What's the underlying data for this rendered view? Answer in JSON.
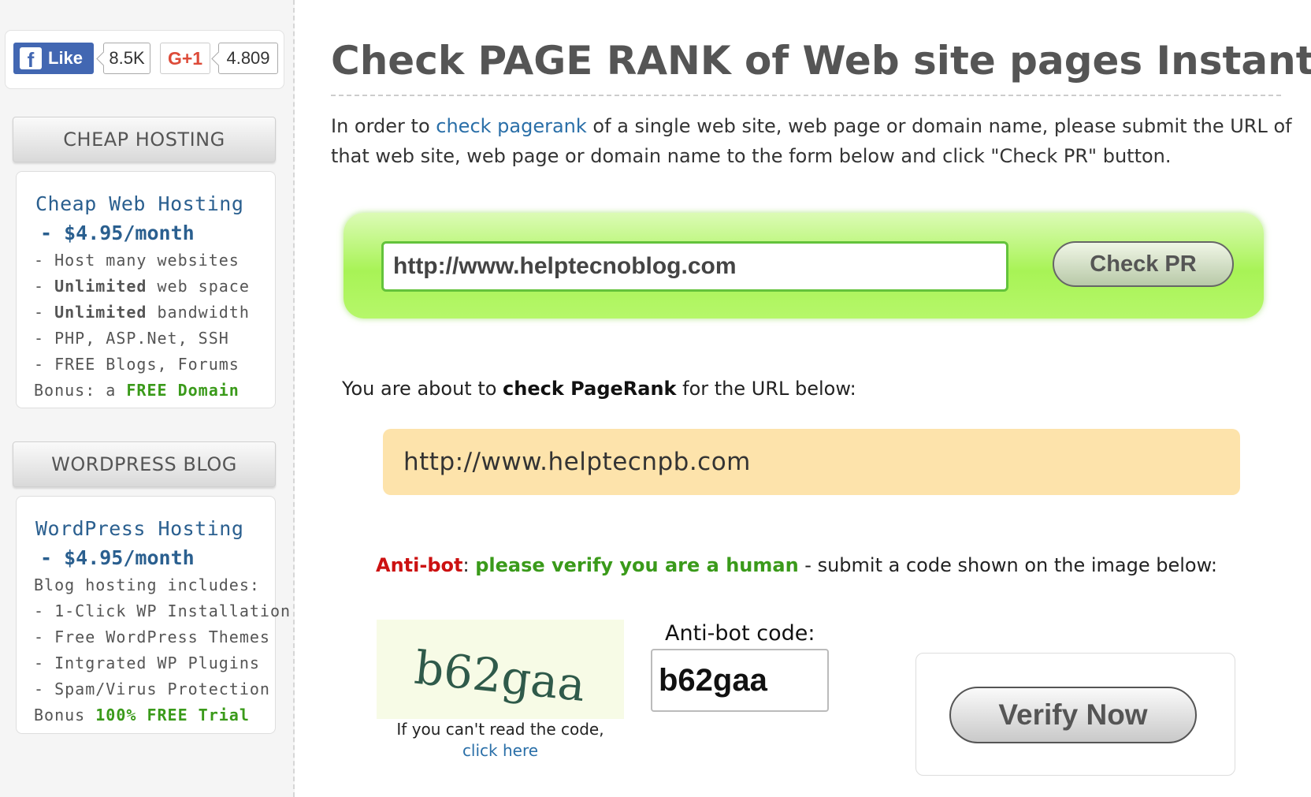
{
  "social": {
    "fb_icon": "f",
    "fb_label": "Like",
    "fb_count": "8.5K",
    "gplus_label": "G+1",
    "gplus_count": "4.809"
  },
  "sidebar": {
    "hosting": {
      "header": "CHEAP HOSTING",
      "title": "Cheap Web Hosting",
      "price": "- $4.95/month",
      "features": [
        {
          "pre": "- Host many websites",
          "bold": "",
          "post": ""
        },
        {
          "pre": "- ",
          "bold": "Unlimited",
          "post": " web space"
        },
        {
          "pre": "- ",
          "bold": "Unlimited",
          "post": " bandwidth"
        },
        {
          "pre": "- PHP, ASP.Net, SSH",
          "bold": "",
          "post": ""
        },
        {
          "pre": "- FREE Blogs, Forums",
          "bold": "",
          "post": ""
        }
      ],
      "bonus_prefix": "Bonus: a ",
      "bonus_highlight": "FREE Domain"
    },
    "wordpress": {
      "header": "WORDPRESS BLOG",
      "title": "WordPress Hosting",
      "price": "- $4.95/month",
      "features": [
        "Blog hosting includes:",
        "- 1-Click WP Installation",
        "- Free WordPress Themes",
        "- Intgrated WP Plugins",
        "- Spam/Virus Protection"
      ],
      "bonus_prefix": "Bonus ",
      "bonus_highlight": "100% FREE Trial"
    }
  },
  "main": {
    "title": "Check PAGE RANK of Web site pages Instantly",
    "intro_pre": "In order to ",
    "intro_link": "check pagerank",
    "intro_post": " of a single web site, web page or domain name, please submit the URL of that web site, web page or domain name to the form below and click \"Check PR\" button.",
    "url_value": "http://www.helptecnoblog.com",
    "check_button": "Check PR",
    "about_pre": "You are about to ",
    "about_bold": "check PageRank",
    "about_post": " for the URL below:",
    "url_display": "http://www.helptecnpb.com",
    "antibot_label": "Anti-bot",
    "antibot_colon": ": ",
    "antibot_verify": "please verify you are a human",
    "antibot_rest": " - submit a code shown on the image below:",
    "captcha_text": "b62gaa",
    "captcha_help": "If you can't read the code,",
    "captcha_link": "click here",
    "code_label": "Anti-bot code:",
    "code_value": "b62gaa",
    "verify_button": "Verify Now"
  },
  "colors": {
    "accent_blue": "#2a5f8f",
    "fb_blue": "#4267b2",
    "gplus_red": "#dd4b39",
    "bonus_green": "#3a9a1a",
    "antibot_red": "#cc1111",
    "panel_green": "#a8f356",
    "url_display_bg": "#fde3ab"
  }
}
